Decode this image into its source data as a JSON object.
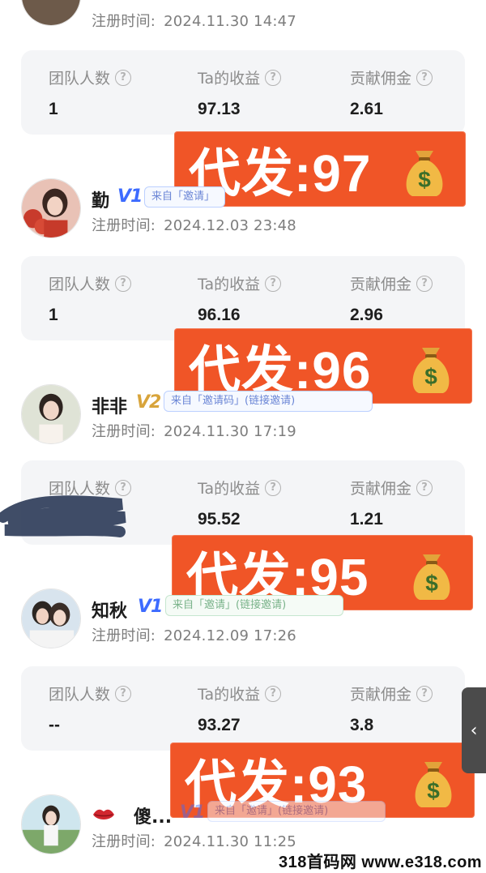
{
  "top_partial": {
    "reg_label": "注册时间:",
    "reg_time": "2024.11.30 14:47"
  },
  "stat_headers": {
    "team": "团队人数",
    "earnings": "Ta的收益",
    "commission": "贡献佣金",
    "help_icon": "question-circle-icon"
  },
  "cards": [
    {
      "team": "1",
      "earnings": "97.13",
      "commission": "2.61"
    },
    {
      "team": "1",
      "earnings": "96.16",
      "commission": "2.96"
    },
    {
      "team": "",
      "earnings": "95.52",
      "commission": "1.21"
    },
    {
      "team": "--",
      "earnings": "93.27",
      "commission": "3.8"
    }
  ],
  "promos": [
    {
      "text": "代发:97",
      "icon": "money-bag-icon"
    },
    {
      "text": "代发:96",
      "icon": "money-bag-icon"
    },
    {
      "text": "代发:95",
      "icon": "money-bag-icon"
    },
    {
      "text": "代发:93",
      "icon": "money-bag-icon"
    }
  ],
  "users": [
    {
      "name": "勤",
      "level": "V1",
      "source": "来自「邀请」",
      "reg_label": "注册时间:",
      "reg_time": "2024.12.03 23:48"
    },
    {
      "name": "非非",
      "level": "V2",
      "source": "来自「邀请码」(链接邀请)",
      "reg_label": "注册时间:",
      "reg_time": "2024.11.30 17:19"
    },
    {
      "name": "知秋",
      "level": "V1",
      "source": "来自「邀请」(链接邀请)",
      "reg_label": "注册时间:",
      "reg_time": "2024.12.09 17:26"
    },
    {
      "name": "傻...",
      "level": "V1",
      "source": "来自「邀请」(链接邀请)",
      "reg_label": "注册时间:",
      "reg_time": "2024.11.30 11:25",
      "prefix_icon": "lips-icon"
    }
  ],
  "side_tab": {
    "icon": "chevron-left-icon",
    "glyph": "‹"
  },
  "watermark": "318首码网 www.e318.com",
  "colors": {
    "promo_bg": "#f05527",
    "card_bg": "#f4f5f7",
    "level_blue": "#3d6bff",
    "level_gold": "#d8a43b"
  }
}
